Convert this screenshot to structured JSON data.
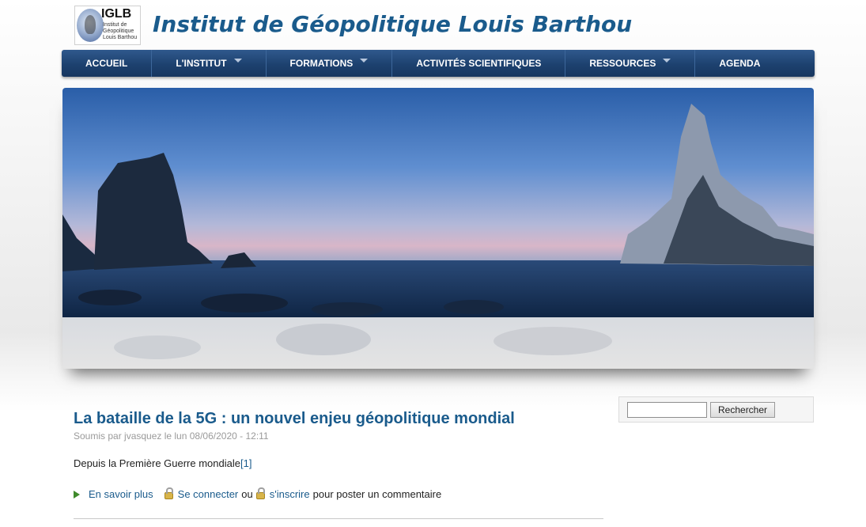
{
  "site": {
    "logo_abbr": "IGLB",
    "logo_subtitle": "Institut de Géopolitique Louis Barthou",
    "title": "Institut de Géopolitique Louis Barthou"
  },
  "nav": {
    "items": [
      {
        "label": "ACCUEIL",
        "has_dropdown": false
      },
      {
        "label": "L'INSTITUT",
        "has_dropdown": true
      },
      {
        "label": "FORMATIONS",
        "has_dropdown": true
      },
      {
        "label": "ACTIVITÉS SCIENTIFIQUES",
        "has_dropdown": false
      },
      {
        "label": "RESSOURCES",
        "has_dropdown": true
      },
      {
        "label": "AGENDA",
        "has_dropdown": false
      }
    ]
  },
  "article": {
    "title": "La bataille de la 5G : un nouvel enjeu géopolitique mondial",
    "meta": "Soumis par jvasquez le lun 08/06/2020 - 12:11",
    "teaser": "Depuis la Première Guerre mondiale",
    "footnote": "[1]",
    "read_more": "En savoir plus",
    "login": "Se connecter",
    "or": "ou",
    "register": "s'inscrire",
    "comment_suffix": "pour poster un commentaire"
  },
  "search": {
    "value": "",
    "button_label": "Rechercher"
  },
  "colors": {
    "brand": "#1a5b8c",
    "nav_bg": "#1d416f"
  }
}
